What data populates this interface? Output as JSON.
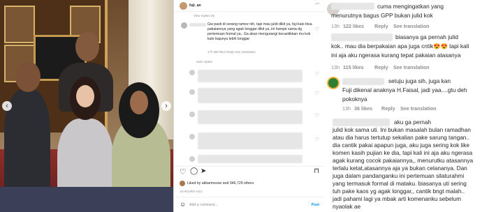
{
  "post": {
    "username": "fuji_an",
    "view_replies": "View replies (9)",
    "main_comment": "Gw pasti di serang ramez nih, tapi mau julid dikit ya, fuji kalo bisa pakaiannya yang agak longgar dikit ya, ini hampir sama dg pertemuan formal ya.. Ga akan mengurangi kecantikkan mu kok kalo bajunya lebih longgar",
    "main_meta": "17h   390 likes   Reply   See translation",
    "hide_replies": "Hide replies",
    "liked_by": "Liked by akbarmoose and 946,729 others",
    "posted_ago": "19 HOURS AGO",
    "add_comment_placeholder": "Add a comment...",
    "post_button": "Post"
  },
  "comments": [
    {
      "text_line1": "cuma mengingatkan yang",
      "text_line2": "menurutnya bagus GPP bukan julid kok",
      "time": "13h",
      "likes": "122 likes",
      "reply": "Reply",
      "see_translation": "See translation"
    },
    {
      "text_line1": "biasanya ga pernah julid",
      "text_line2": "kok.. mau dia berpakaian apa juga cntik😍😍 tapi kali",
      "text_line3": "ini aja aku ngerasa kurang tepat pakaian atasanya",
      "time": "13h",
      "likes": "115 likes",
      "reply": "Reply",
      "see_translation": "See translation"
    },
    {
      "text_line1": "setuju juga sih, juga kan",
      "text_line2": "Fuji dikenal anaknya H.Faisal, jadi yaa....gtu deh",
      "text_line3": "pokoknya",
      "time": "13h",
      "likes": "36 likes",
      "reply": "Reply",
      "see_translation": "See translation"
    },
    {
      "lines": [
        "aku ga pernah",
        "julid kok sama uti. Ini bukan masalah bulan ramadhan",
        "atau dia harus tertutup sekalian pake sarung tangan..",
        "dia cantik pakai apapun juga, aku juga sering kok like",
        "komen kasih pujian ke dia, tapi kali ini aja aku ngerasa",
        "agak kurang cocok pakaiannya,, menurutku atasannya",
        "terlalu ketat,atasannya aja ya bukan celananya. Dan",
        "juga dalam pandanganku ini pertemuan silaturahmi",
        "yang termasuk formal di mataku. biasanya uti sering",
        "tuh pake kaos yg agak longgar,, cantik bngt malah..",
        "jadi pahami lagi ya mbak arti komenanku sebelum",
        "nyaolak ae"
      ]
    }
  ],
  "colors": {
    "meta_gray": "#8e8e8e",
    "text": "#262626",
    "divider": "#dbdbdb"
  }
}
